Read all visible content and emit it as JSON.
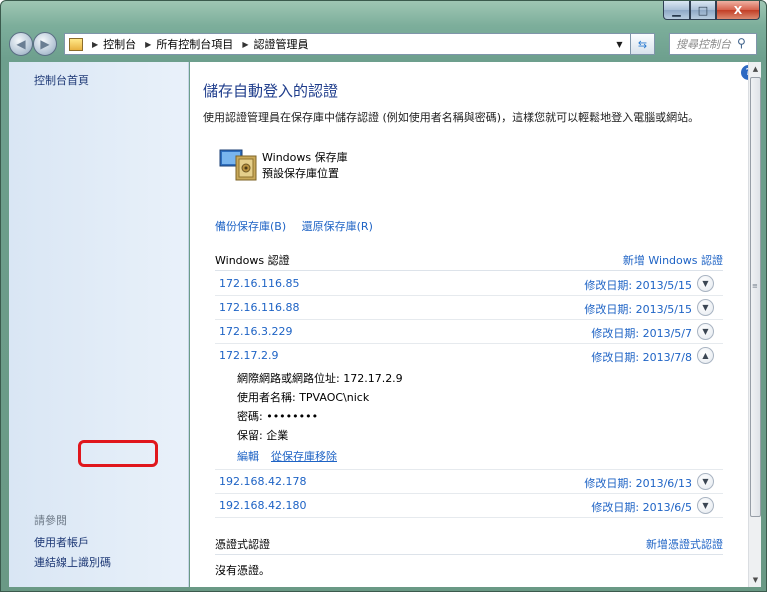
{
  "window": {
    "minimize": "▁",
    "maximize": "□",
    "close": "X"
  },
  "address": {
    "crumbs": [
      "控制台",
      "所有控制台項目",
      "認證管理員"
    ],
    "search_placeholder": "搜尋控制台"
  },
  "sidebar": {
    "home": "控制台首頁",
    "see_also": "請參閱",
    "links": [
      "使用者帳戶",
      "連結線上識別碼"
    ]
  },
  "main": {
    "title": "儲存自動登入的認證",
    "description": "使用認證管理員在保存庫中儲存認證 (例如使用者名稱與密碼)，這樣您就可以輕鬆地登入電腦或網站。",
    "vault_name": "Windows 保存庫",
    "vault_subtitle": "預設保存庫位置",
    "backup_link": "備份保存庫(B)",
    "restore_link": "還原保存庫(R)"
  },
  "windows_credentials": {
    "heading": "Windows 認證",
    "add_link": "新增 Windows 認證",
    "rows": [
      {
        "address": "172.16.116.85",
        "date": "修改日期: 2013/5/15",
        "expanded": false
      },
      {
        "address": "172.16.116.88",
        "date": "修改日期: 2013/5/15",
        "expanded": false
      },
      {
        "address": "172.16.3.229",
        "date": "修改日期: 2013/5/7",
        "expanded": false
      },
      {
        "address": "172.17.2.9",
        "date": "修改日期: 2013/7/8",
        "expanded": true
      }
    ],
    "details": {
      "network_address": "網際網路或網路位址:  172.17.2.9",
      "username": "使用者名稱:  TPVAOC\\nick",
      "password": "密碼:  ••••••••",
      "persistence": "保留:  企業",
      "edit": "編輯",
      "remove": "從保存庫移除"
    },
    "rows_after": [
      {
        "address": "192.168.42.178",
        "date": "修改日期: 2013/6/13"
      },
      {
        "address": "192.168.42.180",
        "date": "修改日期: 2013/6/5"
      }
    ]
  },
  "certificate_credentials": {
    "heading": "憑證式認證",
    "add_link": "新增憑證式認證",
    "empty": "沒有憑證。"
  },
  "colors": {
    "link": "#1e63c5",
    "highlight": "#e0161c"
  }
}
